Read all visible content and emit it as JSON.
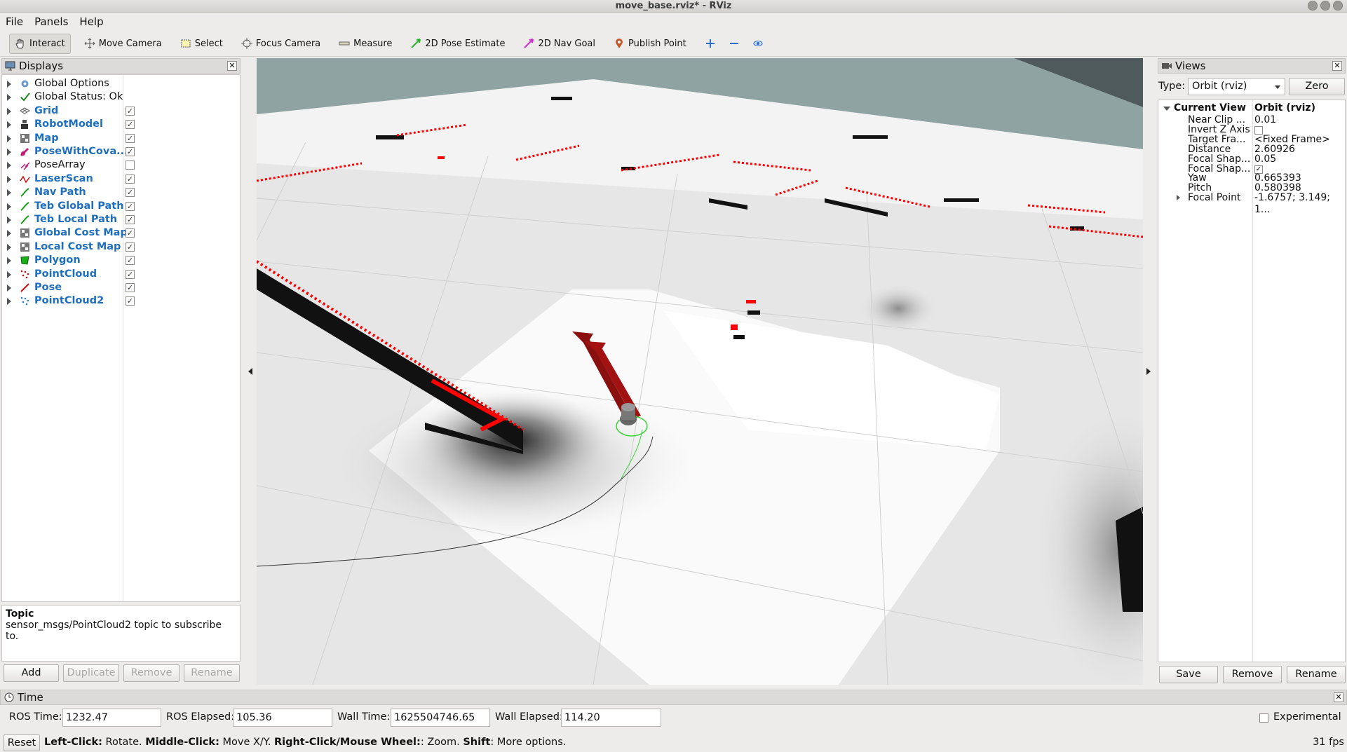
{
  "window": {
    "title": "move_base.rviz* - RViz"
  },
  "menu": [
    "File",
    "Panels",
    "Help"
  ],
  "toolbar": {
    "tools": [
      {
        "label": "Interact",
        "icon": "interact-icon",
        "active": true
      },
      {
        "label": "Move Camera",
        "icon": "move-camera-icon"
      },
      {
        "label": "Select",
        "icon": "select-icon"
      },
      {
        "label": "Focus Camera",
        "icon": "focus-camera-icon"
      },
      {
        "label": "Measure",
        "icon": "measure-icon"
      },
      {
        "label": "2D Pose Estimate",
        "icon": "pose-estimate-icon"
      },
      {
        "label": "2D Nav Goal",
        "icon": "nav-goal-icon"
      },
      {
        "label": "Publish Point",
        "icon": "publish-point-icon"
      }
    ]
  },
  "displays": {
    "title": "Displays",
    "items": [
      {
        "label": "Global Options",
        "icon": "gear-icon",
        "checked": null,
        "blue": false
      },
      {
        "label": "Global Status: Ok",
        "icon": "checkmark-icon",
        "checked": null,
        "blue": false
      },
      {
        "label": "Grid",
        "icon": "grid-icon",
        "checked": true,
        "blue": true
      },
      {
        "label": "RobotModel",
        "icon": "robot-icon",
        "checked": true,
        "blue": true
      },
      {
        "label": "Map",
        "icon": "map-icon",
        "checked": true,
        "blue": true
      },
      {
        "label": "PoseWithCova...",
        "icon": "pose-cov-icon",
        "checked": true,
        "blue": true
      },
      {
        "label": "PoseArray",
        "icon": "pose-array-icon",
        "checked": false,
        "blue": false
      },
      {
        "label": "LaserScan",
        "icon": "laser-icon",
        "checked": true,
        "blue": true
      },
      {
        "label": "Nav Path",
        "icon": "path-icon",
        "checked": true,
        "blue": true
      },
      {
        "label": "Teb Global Path",
        "icon": "path-icon",
        "checked": true,
        "blue": true
      },
      {
        "label": "Teb Local Path",
        "icon": "path-icon",
        "checked": true,
        "blue": true
      },
      {
        "label": "Global Cost Map",
        "icon": "map-icon",
        "checked": true,
        "blue": true
      },
      {
        "label": "Local Cost Map",
        "icon": "map-icon",
        "checked": true,
        "blue": true
      },
      {
        "label": "Polygon",
        "icon": "polygon-icon",
        "checked": true,
        "blue": true
      },
      {
        "label": "PointCloud",
        "icon": "pointcloud-icon",
        "checked": true,
        "blue": true
      },
      {
        "label": "Pose",
        "icon": "pose-icon",
        "checked": true,
        "blue": true
      },
      {
        "label": "PointCloud2",
        "icon": "pointcloud2-icon",
        "checked": true,
        "blue": true
      }
    ],
    "topic_title": "Topic",
    "topic_desc": "sensor_msgs/PointCloud2 topic to subscribe to.",
    "buttons": {
      "add": "Add",
      "duplicate": "Duplicate",
      "remove": "Remove",
      "rename": "Rename"
    }
  },
  "views": {
    "title": "Views",
    "type_label": "Type:",
    "type_value": "Orbit (rviz)",
    "zero": "Zero",
    "current_view": "Current View",
    "current_type": "Orbit (rviz)",
    "props": [
      {
        "k": "Near Clip ...",
        "v": "0.01"
      },
      {
        "k": "Invert Z Axis",
        "v": ""
      },
      {
        "k": "Target Fra...",
        "v": "<Fixed Frame>"
      },
      {
        "k": "Distance",
        "v": "2.60926"
      },
      {
        "k": "Focal Shap...",
        "v": "0.05"
      },
      {
        "k": "Focal Shap...",
        "v": ""
      },
      {
        "k": "Yaw",
        "v": "0.665393"
      },
      {
        "k": "Pitch",
        "v": "0.580398"
      },
      {
        "k": "Focal Point",
        "v": "-1.6757; 3.149; 1..."
      }
    ],
    "buttons": {
      "save": "Save",
      "remove": "Remove",
      "rename": "Rename"
    }
  },
  "time": {
    "title": "Time",
    "ros_time_label": "ROS Time:",
    "ros_time": "1232.47",
    "ros_elapsed_label": "ROS Elapsed:",
    "ros_elapsed": "105.36",
    "wall_time_label": "Wall Time:",
    "wall_time": "1625504746.65",
    "wall_elapsed_label": "Wall Elapsed:",
    "wall_elapsed": "114.20",
    "experimental": "Experimental"
  },
  "status": {
    "reset": "Reset",
    "k1": "Left-Click:",
    "v1": " Rotate. ",
    "k2": "Middle-Click:",
    "v2": " Move X/Y. ",
    "k3": "Right-Click/Mouse Wheel:",
    "v3": ": Zoom. ",
    "k4": "Shift",
    "v4": ": More options.",
    "fps": "31 fps"
  }
}
